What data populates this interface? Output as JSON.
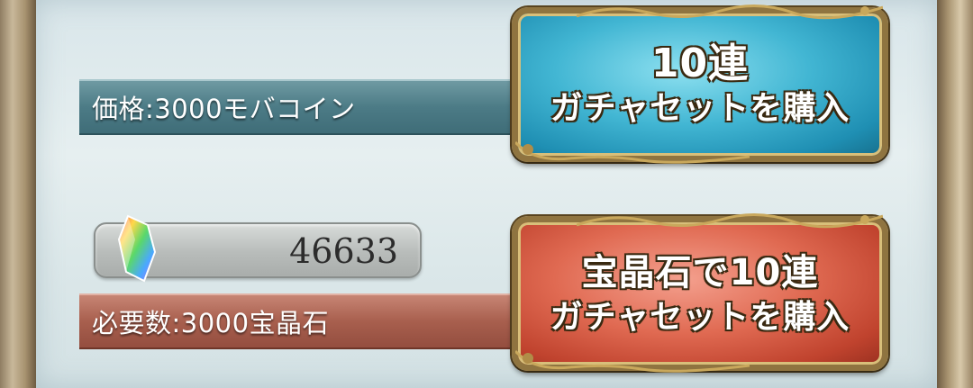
{
  "price_bar": {
    "label": "価格:3000モバコイン"
  },
  "gem_counter": {
    "value": "46633",
    "icon": "rainbow-crystal-icon"
  },
  "required_bar": {
    "label": "必要数:3000宝晶石"
  },
  "buy_coin_button": {
    "line1": "10連",
    "line2": "ガチャセットを購入"
  },
  "buy_gem_button": {
    "line1": "宝晶石で10連",
    "line2": "ガチャセットを購入"
  },
  "colors": {
    "blue_button": "#42b6d3",
    "red_button": "#e06a52",
    "price_bar": "#4c7b86",
    "required_bar": "#a85f4e"
  }
}
